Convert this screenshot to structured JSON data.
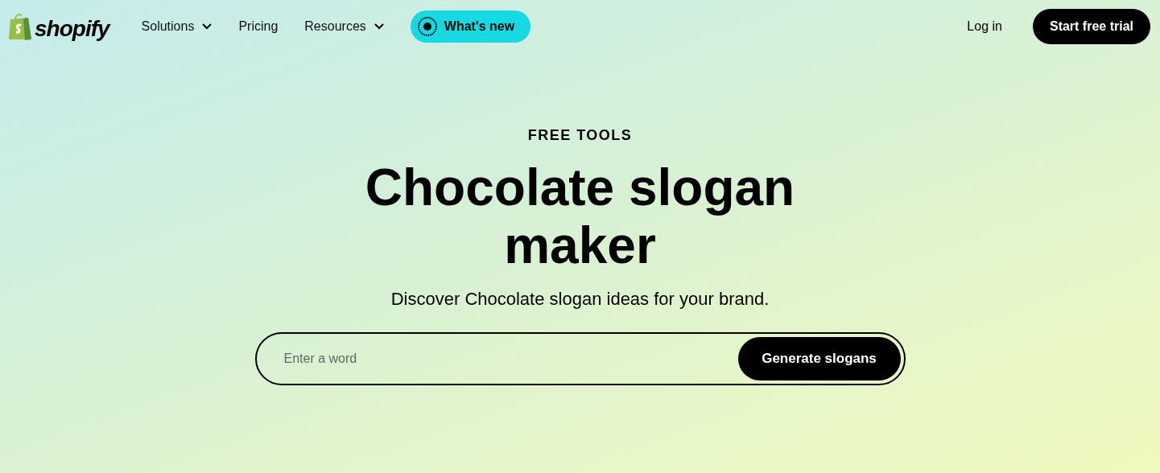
{
  "logo": {
    "text": "shopify"
  },
  "nav": [
    {
      "label": "Solutions",
      "has_menu": true
    },
    {
      "label": "Pricing",
      "has_menu": false
    },
    {
      "label": "Resources",
      "has_menu": true
    }
  ],
  "whats_new": {
    "label": "What's new"
  },
  "login": {
    "label": "Log in"
  },
  "cta": {
    "label": "Start free trial"
  },
  "hero": {
    "eyebrow": "FREE TOOLS",
    "title": "Chocolate slogan maker",
    "subtitle": "Discover Chocolate slogan ideas for your brand."
  },
  "form": {
    "placeholder": "Enter a word",
    "button": "Generate slogans"
  }
}
